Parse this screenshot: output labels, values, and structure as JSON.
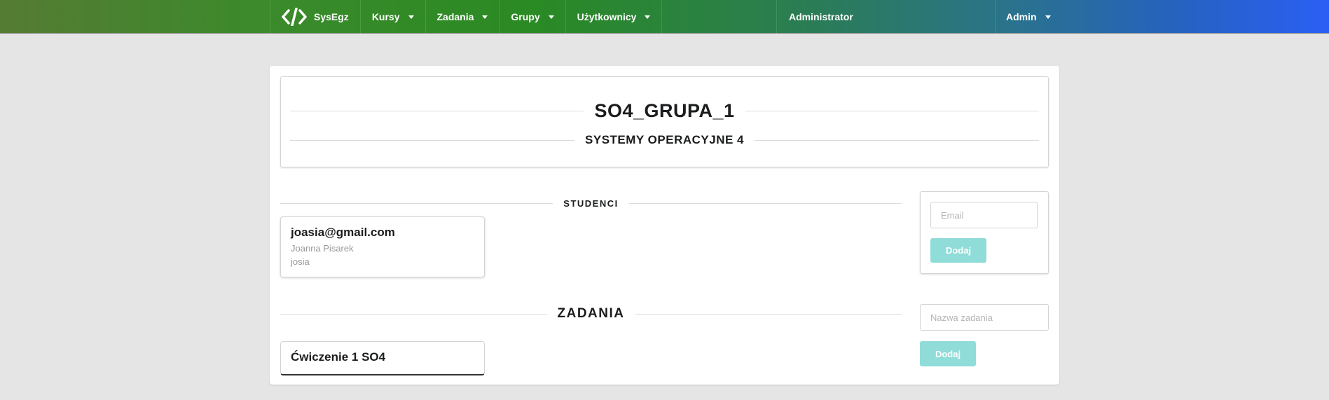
{
  "navbar": {
    "brand": "SysEgz",
    "brand_icon": "code-icon",
    "menus": [
      {
        "label": "Kursy"
      },
      {
        "label": "Zadania"
      },
      {
        "label": "Grupy"
      },
      {
        "label": "Użytkownicy"
      }
    ],
    "role_text": "Administrator",
    "user_menu": "Admin"
  },
  "group": {
    "name": "SO4_GRUPA_1",
    "course": "SYSTEMY OPERACYJNE 4"
  },
  "students_section": {
    "heading": "STUDENCI",
    "students": [
      {
        "email": "joasia@gmail.com",
        "full_name": "Joanna Pisarek",
        "username": "josia"
      }
    ]
  },
  "tasks_section": {
    "heading": "ZADANIA",
    "tasks": [
      {
        "title": "Ćwiczenie 1 SO4"
      }
    ]
  },
  "add_student": {
    "placeholder": "Email",
    "button": "Dodaj"
  },
  "add_task": {
    "placeholder": "Nazwa zadania",
    "button": "Dodaj"
  },
  "colors": {
    "page_bg": "#e5e5e5",
    "button_teal": "#8fdcd8",
    "nav_gradient_start": "#557b33",
    "nav_gradient_end": "#2a5ff5"
  }
}
